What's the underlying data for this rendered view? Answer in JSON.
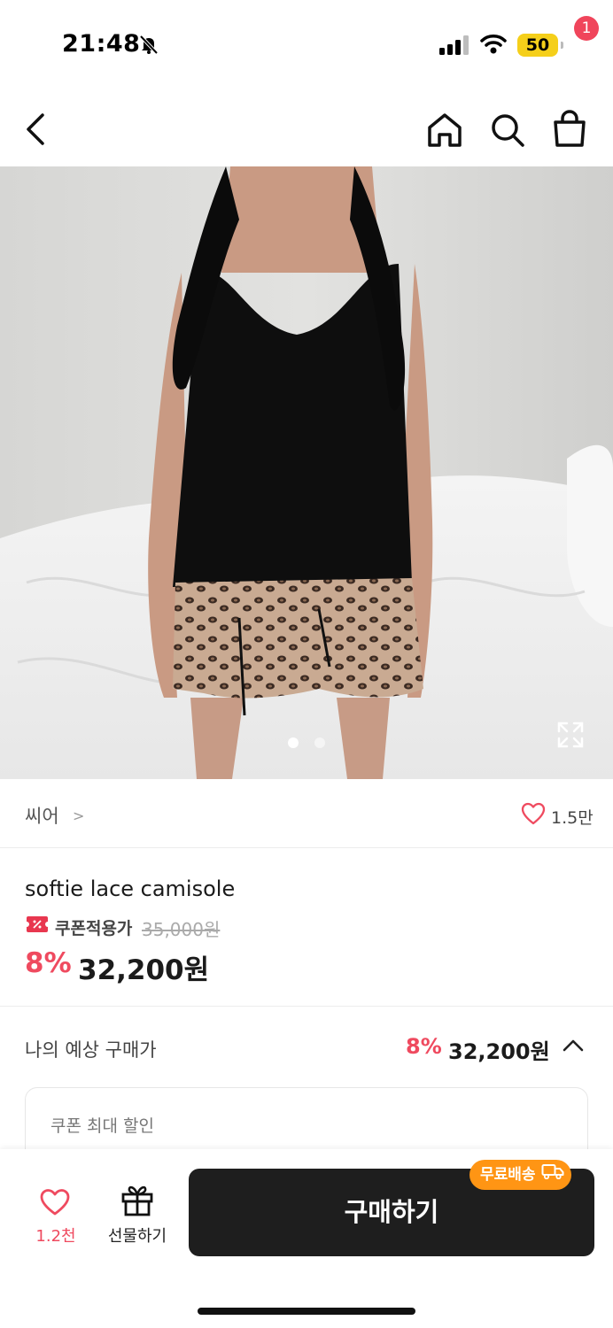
{
  "status_bar": {
    "time": "21:48",
    "battery": "50",
    "icons": [
      "bell-off-icon",
      "signal-icon",
      "wifi-icon",
      "battery-icon"
    ]
  },
  "nav": {
    "icons": [
      "back-icon",
      "home-icon",
      "search-icon",
      "cart-icon"
    ],
    "cart_count": "1"
  },
  "gallery": {
    "image_count": 2,
    "current_index": 1,
    "icons": [
      "expand-icon"
    ]
  },
  "brand": {
    "name": "씨어",
    "chevron": ">",
    "likes": "1.5만"
  },
  "product": {
    "name": "softie lace camisole",
    "coupon_label": "쿠폰적용가",
    "original_price": "35,000원",
    "discount": "8%",
    "price": "32,200원"
  },
  "expected_price": {
    "label": "나의 예상 구매가",
    "discount": "8%",
    "price": "32,200원"
  },
  "coupon_card": {
    "label": "쿠폰 최대 할인"
  },
  "bottom_bar": {
    "wish_count": "1.2천",
    "gift_label": "선물하기",
    "buy_label": "구매하기",
    "shipping_badge": "무료배송"
  },
  "colors": {
    "accent_red": "#ef4a5f",
    "buy_button": "#1e1e1e",
    "shipping_orange": "#ff9514",
    "battery_yellow": "#f5cf1a"
  }
}
